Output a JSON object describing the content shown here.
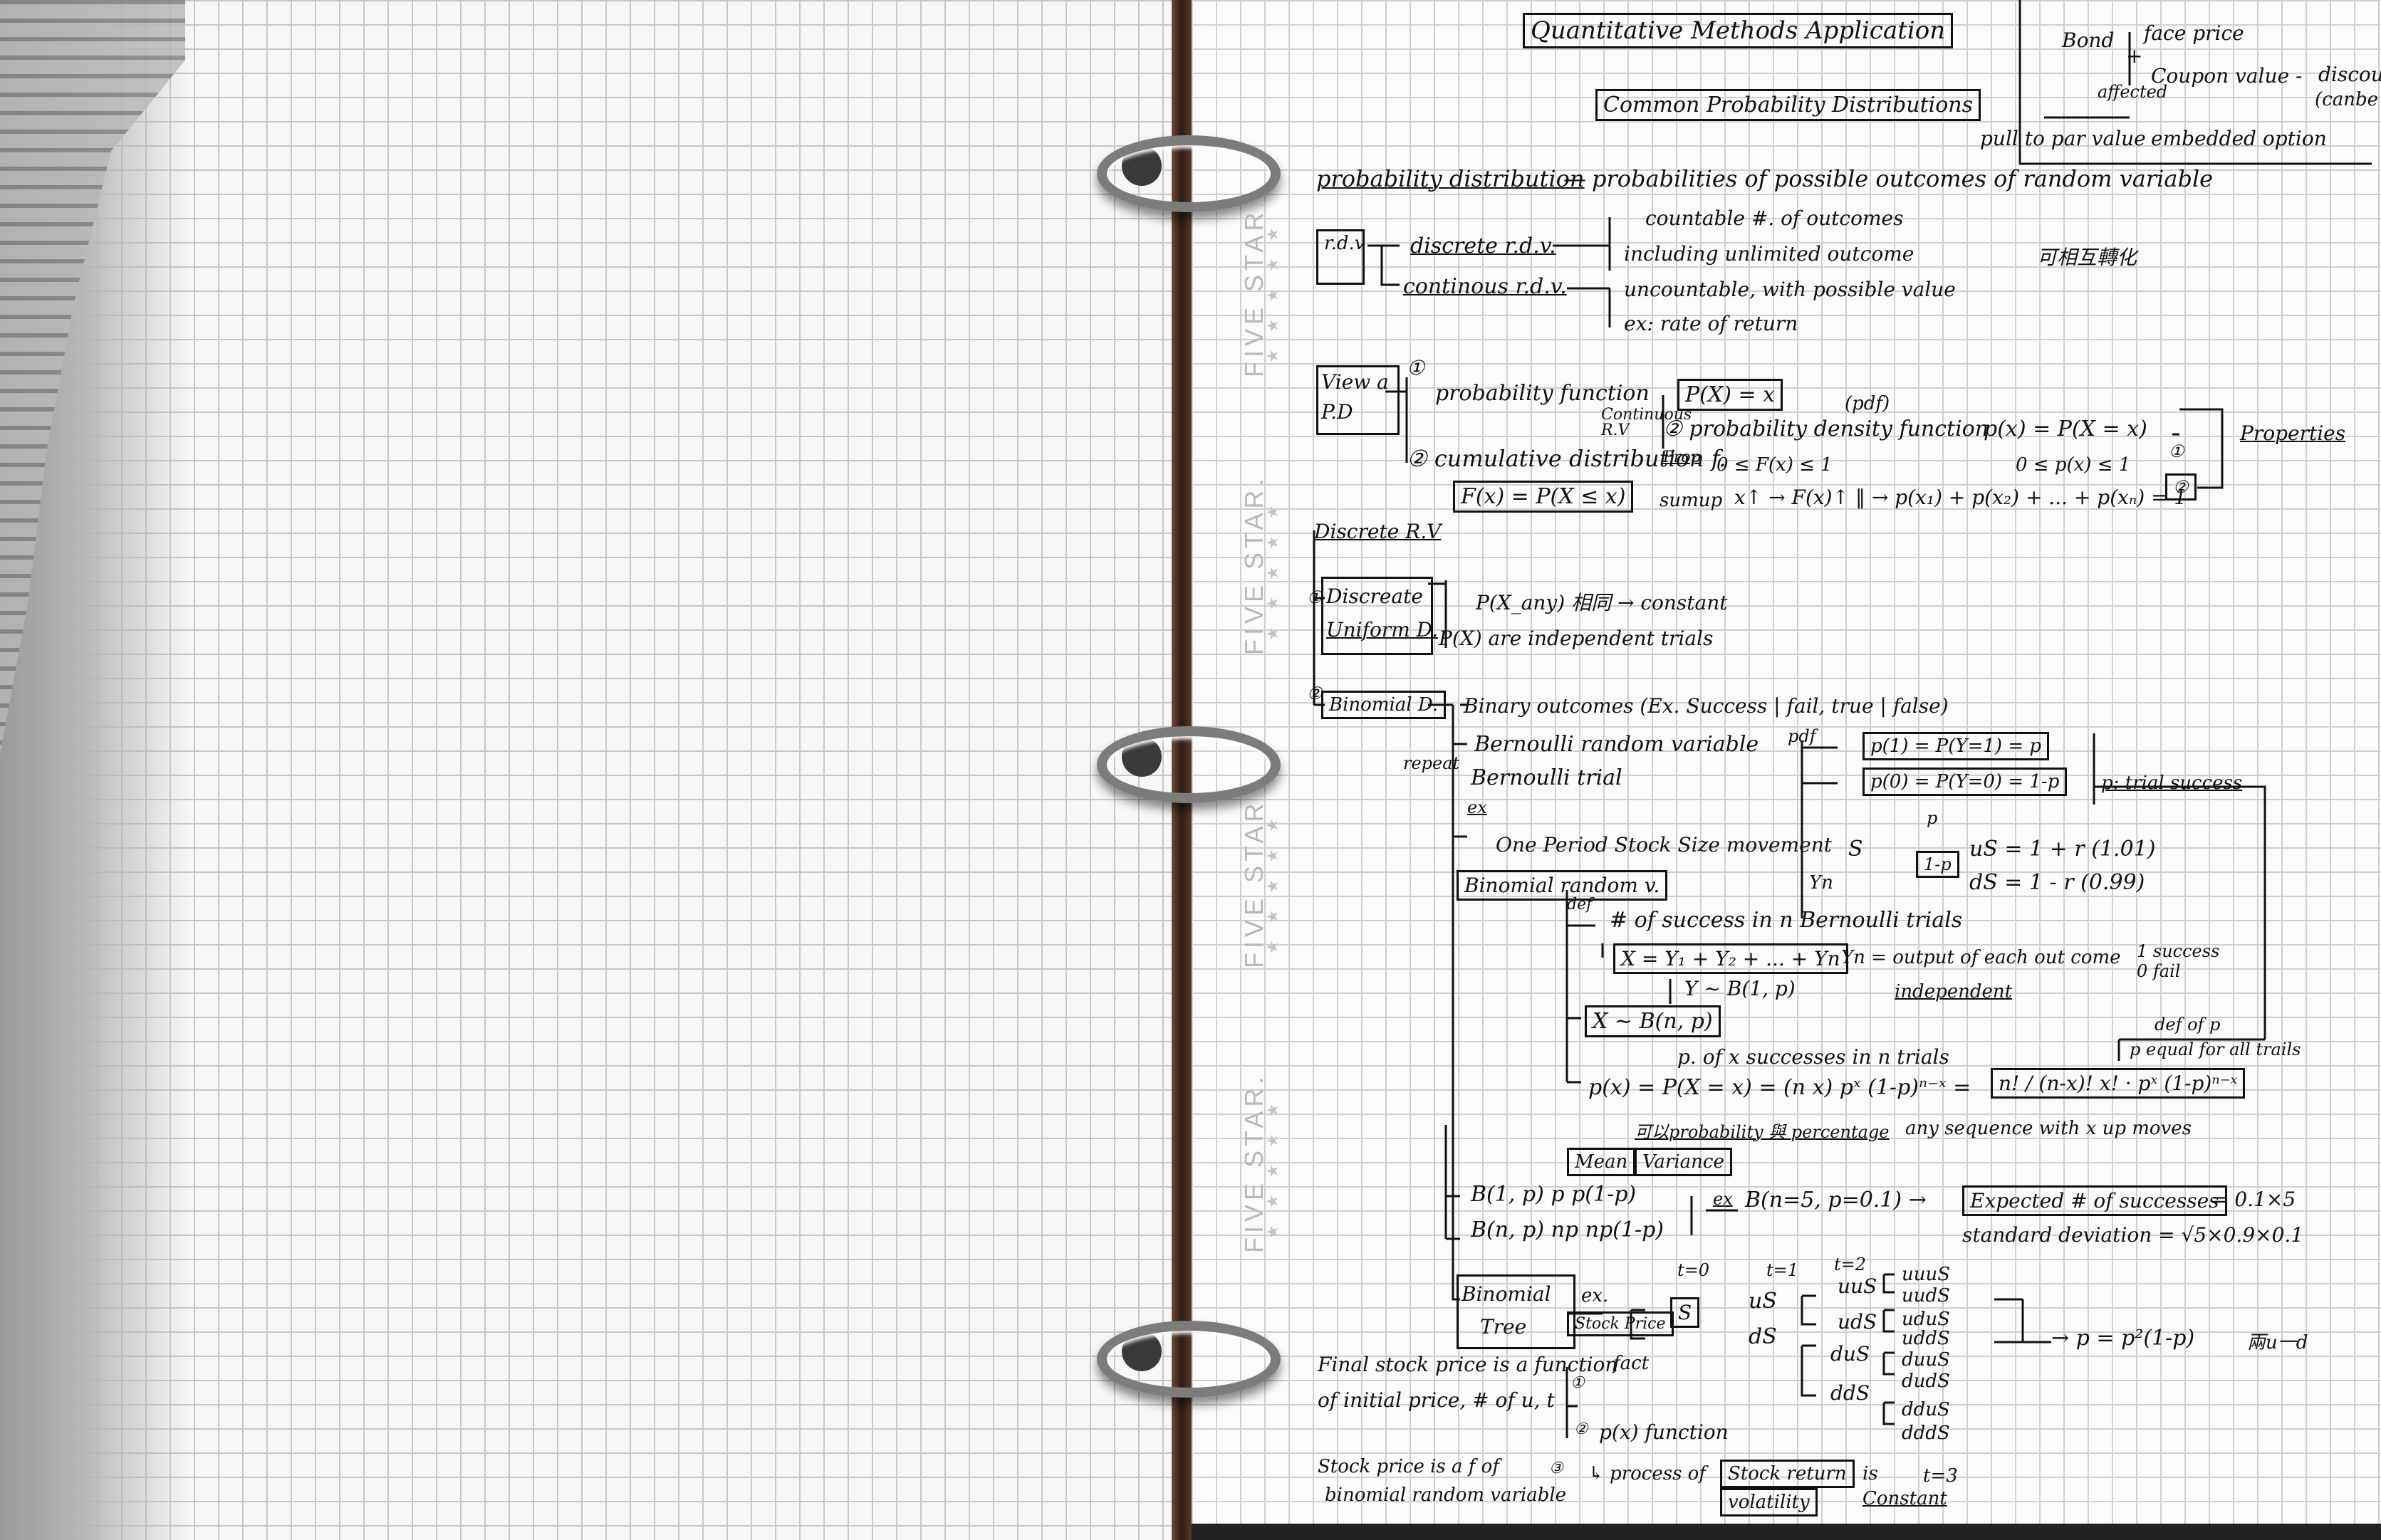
{
  "notebook": {
    "brand_text": "FIVE STAR.",
    "stars": "★ ★ ★ ★ ★"
  },
  "header": {
    "title": "Quantitative Methods Application",
    "subtitle": "Common Probability Distributions"
  },
  "bond_note": {
    "bond": "Bond",
    "face_price": "face price",
    "plus": "+",
    "coupon_value": "Coupon value -",
    "discount": "discou",
    "cant": "(canbe",
    "affected": "affected",
    "pull_to_par": "pull to par value",
    "embedded": "embedded option"
  },
  "definition": {
    "term": "probability distribution",
    "dash": "—",
    "text": "probabilities of possible outcomes of random variable"
  },
  "rv": {
    "label": "r.d.v",
    "discrete": "discrete r.d.v.",
    "continuous": "continous r.d.v.",
    "countable": "countable #. of outcomes",
    "unlimited": "including unlimited outcome",
    "chinese": "可相互轉化",
    "uncountable": "uncountable, with possible value",
    "example": "ex: rate of return"
  },
  "view": {
    "label1": "View a",
    "label2": "P.D",
    "n1": "①",
    "prob_fn": "probability function",
    "p_eq": "P(X) = x",
    "continuous_rv": "Continuous R.V",
    "pdf_tag": "(pdf)",
    "pdf": "② probability density function",
    "pdf_eq": "p(x) = P(X = x)",
    "properties": "Properties",
    "cdf": "② cumulative distribution f.",
    "prop": "Prop",
    "cdf_range": "0 ≤ F(x) ≤ 1",
    "pdf_range": "0 ≤ p(x) ≤ 1",
    "cdf_def": "F(x) = P(X ≤ x)",
    "sumup": "sumup",
    "increasing": "x↑ → F(x)↑ ‖ → p(x₁) + p(x₂) + ... + p(xₙ) = 1",
    "c1": "①",
    "c2": "②"
  },
  "discrete": {
    "heading": "Discrete R.V",
    "uniform1": "Discreate",
    "uniform2": "Uniform D.",
    "n1": "①",
    "n2": "②",
    "u1": "P(X_any) 相同 → constant",
    "u2": "P(X) are independent trials",
    "binomial": "Binomial D.",
    "binary": "Binary outcomes (Ex. Success | fail, true | false)",
    "bernoulli_rv": "Bernoulli random variable",
    "pdf": "pdf",
    "p1": "p(1) = P(Y=1) = p",
    "p0": "p(0) = P(Y=0) = 1-p",
    "p_trial": "p: trial success",
    "repeat": "repeat",
    "bernoulli_trial": "Bernoulli trial",
    "ex": "ex",
    "one_period": "One Period Stock Size movement",
    "s": "S",
    "p": "p",
    "one_minus_p": "1-p",
    "us": "uS = 1 + r  (1.01)",
    "ds": "dS = 1 - r  (0.99)",
    "yn": "Yn",
    "binomial_rv": "Binomial random v.",
    "def": "def",
    "num_success": "# of success in n Bernoulli trials",
    "x_sum": "X = Y₁ + Y₂ + ... + Yn",
    "yn_output": "Yn = output of each out come",
    "one_success": "1 success",
    "zero_fail": "0 fail",
    "independent": "independent",
    "y_dist": "Y ~ B(1, p)",
    "x_dist": "X ~ B(n, p)",
    "def_of_p": "def of p",
    "p_equal": "p equal for all trails",
    "p_of_x": "p. of x successes in n trials",
    "formula": "p(x) = P(X = x) = (n x) pˣ (1-p)ⁿ⁻ˣ =",
    "formula_r": "n! / (n-x)! x! · pˣ (1-p)ⁿ⁻ˣ",
    "formula_note": "可以probability 與 percentage",
    "any_seq": "any sequence with x up moves",
    "mean": "Mean",
    "variance": "Variance",
    "b1": "B(1, p)    p      p(1-p)",
    "bn": "B(n, p)    np     np(1-p)",
    "ex2": "ex",
    "bex": "B(n=5, p=0.1) →",
    "expected": "Expected # of successes",
    "exp_val": "= 0.1×5",
    "stddev": "standard deviation = √5×0.9×0.1",
    "tree1": "Binomial",
    "tree2": "Tree",
    "ex3": "ex.",
    "stock_price": "Stock Price",
    "t0": "t=0",
    "t1": "t=1",
    "t2": "t=2",
    "t3": "t=3",
    "node_s": "S",
    "node_us": "uS",
    "node_ds": "dS",
    "uus": "uuS",
    "uds": "udS",
    "dus": "duS",
    "dds": "ddS",
    "uuus": "uuuS",
    "uuds": "uudS",
    "udus": "uduS",
    "udds": "uddS",
    "duus": "duuS",
    "duds": "dudS",
    "ddus": "dduS",
    "ddds": "dddS",
    "result": "→ p = p²(1-p)",
    "result_note": "兩u一d",
    "final_stock1": "Final stock price is a function",
    "fact": "fact",
    "final_stock2": "of initial price, # of u, t",
    "c_one": "①",
    "c_two": "②",
    "c_three": "③",
    "px_function": "p(x) function",
    "stock_fn1": "Stock price is a f of",
    "stock_fn2": "binomial random variable",
    "process": "↳ process of",
    "stock_return": "Stock return",
    "volatility": "volatility",
    "is": "is",
    "constant": "Constant"
  }
}
